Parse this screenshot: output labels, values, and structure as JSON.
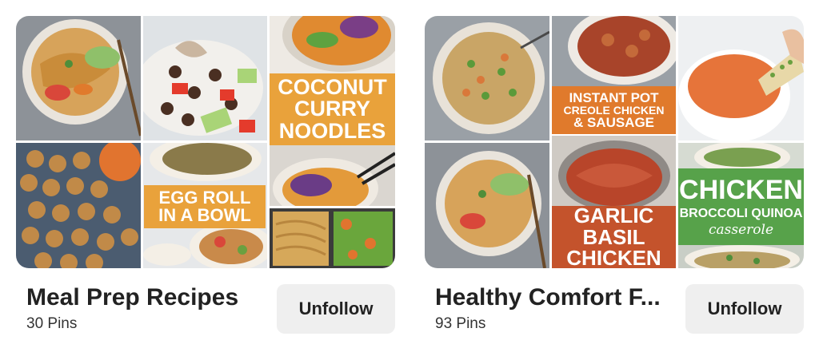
{
  "boards": [
    {
      "title": "Meal Prep Recipes",
      "pin_count": "30 Pins",
      "action_label": "Unfollow",
      "tiles": [
        {
          "name": "noodle-bowl-image"
        },
        {
          "name": "bean-salad-image"
        },
        {
          "name": "curry-bowl-image"
        },
        {
          "name": "meatballs-image"
        },
        {
          "name": "egg-roll-bowl-image"
        },
        {
          "name": "pasta-salad-image"
        }
      ],
      "overlays": {
        "coconut_curry": [
          "COCONUT",
          "CURRY",
          "NOODLES"
        ],
        "egg_roll": [
          "EGG ROLL",
          "IN A BOWL"
        ]
      }
    },
    {
      "title": "Healthy Comfort F...",
      "pin_count": "93 Pins",
      "action_label": "Unfollow",
      "tiles": [
        {
          "name": "quinoa-bowl-image"
        },
        {
          "name": "chicken-sausage-image"
        },
        {
          "name": "tomato-soup-image"
        },
        {
          "name": "noodle-bowl-image"
        },
        {
          "name": "garlic-chicken-image"
        },
        {
          "name": "chicken-quinoa-image"
        }
      ],
      "overlays": {
        "instant_pot": [
          "INSTANT POT",
          "CREOLE CHICKEN",
          "& SAUSAGE"
        ],
        "garlic_basil": [
          "GARLIC",
          "BASIL",
          "CHICKEN"
        ],
        "chicken_broccoli": [
          "CHICKEN",
          "BROCCOLI QUINOA",
          "casserole"
        ]
      }
    }
  ],
  "colors": {
    "orange_banner": "#e9a23b",
    "red_banner": "#c4532c",
    "green_banner": "#57a24a",
    "button_bg": "#efefef"
  }
}
